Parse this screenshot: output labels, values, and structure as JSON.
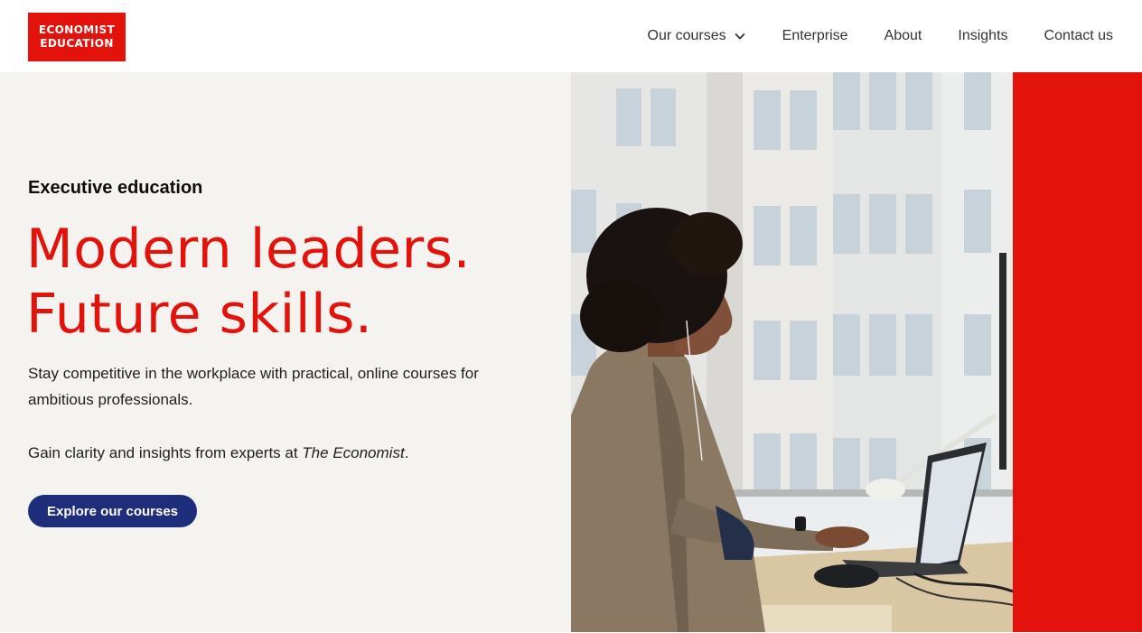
{
  "header": {
    "logo": {
      "line1": "ECONOMIST",
      "line2": "EDUCATION"
    },
    "nav": [
      {
        "label": "Our courses",
        "has_dropdown": true
      },
      {
        "label": "Enterprise"
      },
      {
        "label": "About"
      },
      {
        "label": "Insights"
      },
      {
        "label": "Contact us"
      }
    ]
  },
  "hero": {
    "eyebrow": "Executive education",
    "headline_line1": "Modern leaders.",
    "headline_line2": "Future skills.",
    "paragraph1": "Stay competitive in the workplace with practical, online courses for ambitious professionals.",
    "paragraph2_prefix": "Gain clarity and insights from experts at ",
    "paragraph2_italic": "The Economist",
    "paragraph2_suffix": ".",
    "cta_label": "Explore our courses"
  },
  "colors": {
    "brand_red": "#e3120b",
    "cta_navy": "#1f2e7a",
    "hero_bg": "#f4f3ef"
  },
  "icons": {
    "dropdown": "chevron-down-icon"
  }
}
